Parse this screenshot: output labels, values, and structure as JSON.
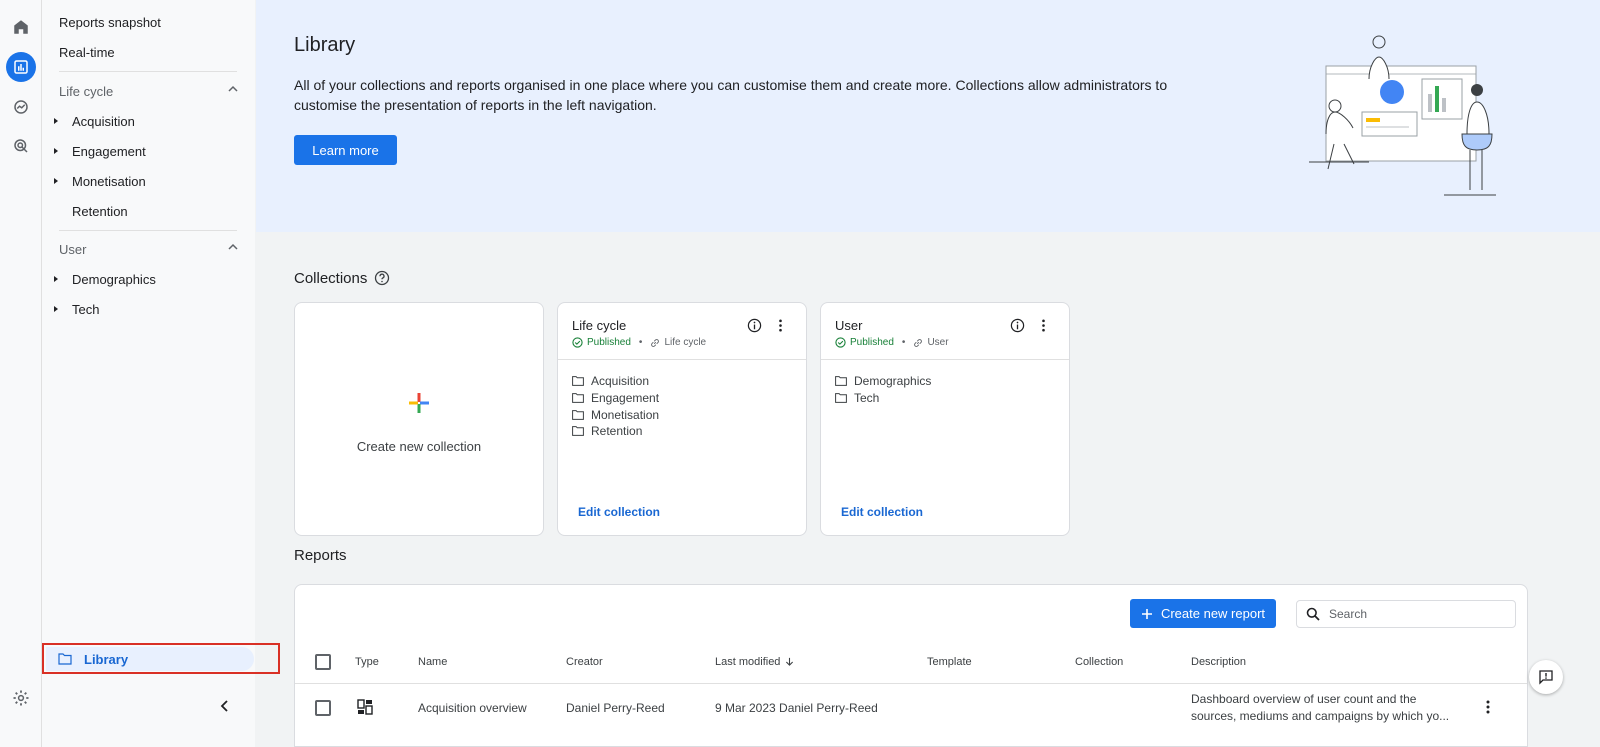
{
  "colors": {
    "accent": "#1a73e8",
    "published": "#188038",
    "hero_bg": "#e8f0fe",
    "highlight_border": "#d93025"
  },
  "rail": {
    "items": [
      {
        "icon": "home-icon"
      },
      {
        "icon": "reports-icon",
        "active": true
      },
      {
        "icon": "explore-icon"
      },
      {
        "icon": "advertising-icon"
      },
      {
        "icon": "settings-icon"
      }
    ]
  },
  "sidebar": {
    "top_items": [
      "Reports snapshot",
      "Real-time"
    ],
    "life_cycle": {
      "heading": "Life cycle",
      "items": [
        "Acquisition",
        "Engagement",
        "Monetisation",
        "Retention"
      ]
    },
    "user": {
      "heading": "User",
      "items": [
        "Demographics",
        "Tech"
      ]
    },
    "library_label": "Library"
  },
  "hero": {
    "title": "Library",
    "description": "All of your collections and reports organised in one place where you can customise them and create more. Collections allow administrators to customise the presentation of reports in the left navigation.",
    "learn_more": "Learn more"
  },
  "collections": {
    "title": "Collections",
    "create_label": "Create new collection",
    "cards": [
      {
        "title": "Life cycle",
        "status": "Published",
        "source": "Life cycle",
        "folders": [
          "Acquisition",
          "Engagement",
          "Monetisation",
          "Retention"
        ],
        "edit": "Edit collection"
      },
      {
        "title": "User",
        "status": "Published",
        "source": "User",
        "folders": [
          "Demographics",
          "Tech"
        ],
        "edit": "Edit collection"
      }
    ]
  },
  "reports": {
    "title": "Reports",
    "create_button": "Create new report",
    "search_placeholder": "Search",
    "columns": [
      "Type",
      "Name",
      "Creator",
      "Last modified",
      "Template",
      "Collection",
      "Description"
    ],
    "rows": [
      {
        "name": "Acquisition overview",
        "creator": "Daniel Perry-Reed",
        "last_modified": "9 Mar 2023 Daniel Perry-Reed",
        "template": "",
        "collection": "",
        "description_line1": "Dashboard overview of user count and the",
        "description_line2": "sources, mediums and campaigns by which yo..."
      }
    ]
  }
}
